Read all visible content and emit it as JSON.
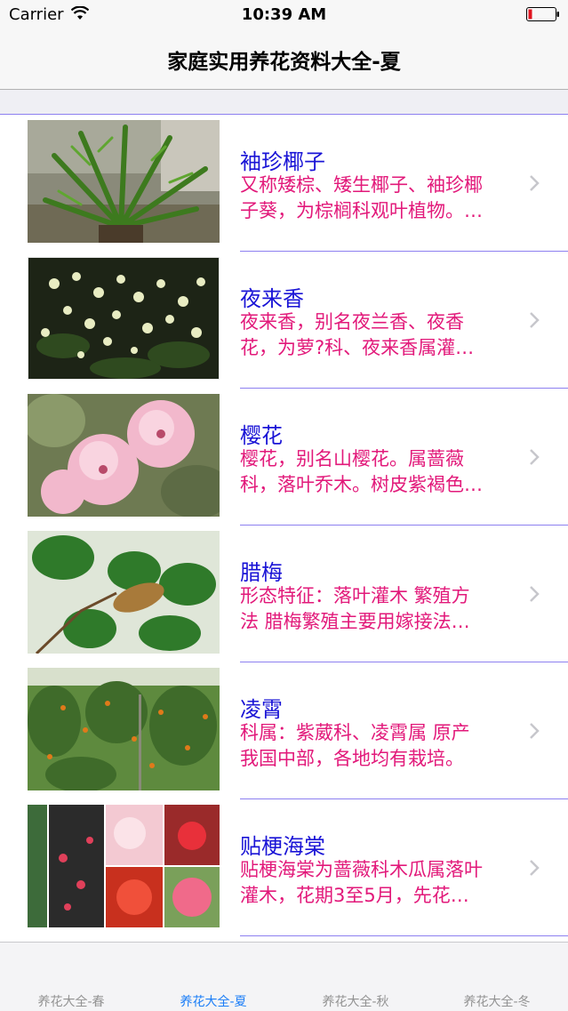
{
  "status_bar": {
    "carrier": "Carrier",
    "time": "10:39 AM"
  },
  "nav": {
    "title": "家庭实用养花资料大全-夏"
  },
  "colors": {
    "title_text": "#1a14d6",
    "desc_text": "#e2197a",
    "divider": "#8d80f0",
    "tab_active": "#1a7df7",
    "tab_inactive": "#929292"
  },
  "items": [
    {
      "title": "袖珍椰子",
      "desc_line1": "又称矮棕、矮生椰子、袖珍椰",
      "desc_line2": "子葵，为棕榈科观叶植物。…",
      "image": "palm-plant"
    },
    {
      "title": "夜来香",
      "desc_line1": "夜来香，别名夜兰香、夜香",
      "desc_line2": "花，为萝?科、夜来香属灌…",
      "image": "night-jasmine"
    },
    {
      "title": "樱花",
      "desc_line1": "樱花，别名山樱花。属蔷薇",
      "desc_line2": "科，落叶乔木。树皮紫褐色…",
      "image": "cherry-blossom"
    },
    {
      "title": "腊梅",
      "desc_line1": "形态特征：落叶灌木 繁殖方",
      "desc_line2": "法 腊梅繁殖主要用嫁接法…",
      "image": "wintersweet"
    },
    {
      "title": "凌霄",
      "desc_line1": "科属：紫葳科、凌霄属 原产",
      "desc_line2": "我国中部，各地均有栽培。",
      "image": "trumpet-creeper"
    },
    {
      "title": "贴梗海棠",
      "desc_line1": "贴梗海棠为蔷薇科木瓜属落叶",
      "desc_line2": "灌木，花期3至5月，先花…",
      "image": "flowering-quince"
    }
  ],
  "tabs": [
    {
      "label": "养花大全-春",
      "active": false
    },
    {
      "label": "养花大全-夏",
      "active": true
    },
    {
      "label": "养花大全-秋",
      "active": false
    },
    {
      "label": "养花大全-冬",
      "active": false
    }
  ]
}
